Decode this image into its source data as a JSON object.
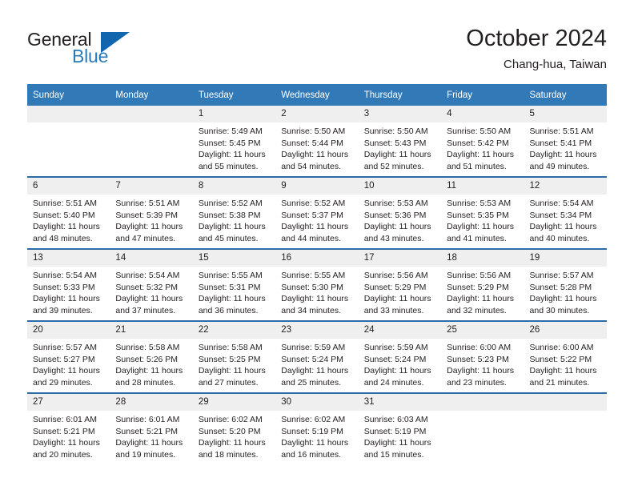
{
  "brand": {
    "name_part1": "General",
    "name_part2": "Blue",
    "triangle_color": "#1166ad",
    "blue_color": "#2b7ab8"
  },
  "header": {
    "title": "October 2024",
    "subtitle": "Chang-hua, Taiwan",
    "header_bg": "#3279b8",
    "row_divider": "#2d6ca8",
    "daynum_bg": "#efefef"
  },
  "weekday_headers": [
    "Sunday",
    "Monday",
    "Tuesday",
    "Wednesday",
    "Thursday",
    "Friday",
    "Saturday"
  ],
  "weeks": [
    [
      {
        "day": "",
        "sunrise": "",
        "sunset": "",
        "daylight1": "",
        "daylight2": "",
        "empty": true
      },
      {
        "day": "",
        "sunrise": "",
        "sunset": "",
        "daylight1": "",
        "daylight2": "",
        "empty": true
      },
      {
        "day": "1",
        "sunrise": "Sunrise: 5:49 AM",
        "sunset": "Sunset: 5:45 PM",
        "daylight1": "Daylight: 11 hours",
        "daylight2": "and 55 minutes."
      },
      {
        "day": "2",
        "sunrise": "Sunrise: 5:50 AM",
        "sunset": "Sunset: 5:44 PM",
        "daylight1": "Daylight: 11 hours",
        "daylight2": "and 54 minutes."
      },
      {
        "day": "3",
        "sunrise": "Sunrise: 5:50 AM",
        "sunset": "Sunset: 5:43 PM",
        "daylight1": "Daylight: 11 hours",
        "daylight2": "and 52 minutes."
      },
      {
        "day": "4",
        "sunrise": "Sunrise: 5:50 AM",
        "sunset": "Sunset: 5:42 PM",
        "daylight1": "Daylight: 11 hours",
        "daylight2": "and 51 minutes."
      },
      {
        "day": "5",
        "sunrise": "Sunrise: 5:51 AM",
        "sunset": "Sunset: 5:41 PM",
        "daylight1": "Daylight: 11 hours",
        "daylight2": "and 49 minutes."
      }
    ],
    [
      {
        "day": "6",
        "sunrise": "Sunrise: 5:51 AM",
        "sunset": "Sunset: 5:40 PM",
        "daylight1": "Daylight: 11 hours",
        "daylight2": "and 48 minutes."
      },
      {
        "day": "7",
        "sunrise": "Sunrise: 5:51 AM",
        "sunset": "Sunset: 5:39 PM",
        "daylight1": "Daylight: 11 hours",
        "daylight2": "and 47 minutes."
      },
      {
        "day": "8",
        "sunrise": "Sunrise: 5:52 AM",
        "sunset": "Sunset: 5:38 PM",
        "daylight1": "Daylight: 11 hours",
        "daylight2": "and 45 minutes."
      },
      {
        "day": "9",
        "sunrise": "Sunrise: 5:52 AM",
        "sunset": "Sunset: 5:37 PM",
        "daylight1": "Daylight: 11 hours",
        "daylight2": "and 44 minutes."
      },
      {
        "day": "10",
        "sunrise": "Sunrise: 5:53 AM",
        "sunset": "Sunset: 5:36 PM",
        "daylight1": "Daylight: 11 hours",
        "daylight2": "and 43 minutes."
      },
      {
        "day": "11",
        "sunrise": "Sunrise: 5:53 AM",
        "sunset": "Sunset: 5:35 PM",
        "daylight1": "Daylight: 11 hours",
        "daylight2": "and 41 minutes."
      },
      {
        "day": "12",
        "sunrise": "Sunrise: 5:54 AM",
        "sunset": "Sunset: 5:34 PM",
        "daylight1": "Daylight: 11 hours",
        "daylight2": "and 40 minutes."
      }
    ],
    [
      {
        "day": "13",
        "sunrise": "Sunrise: 5:54 AM",
        "sunset": "Sunset: 5:33 PM",
        "daylight1": "Daylight: 11 hours",
        "daylight2": "and 39 minutes."
      },
      {
        "day": "14",
        "sunrise": "Sunrise: 5:54 AM",
        "sunset": "Sunset: 5:32 PM",
        "daylight1": "Daylight: 11 hours",
        "daylight2": "and 37 minutes."
      },
      {
        "day": "15",
        "sunrise": "Sunrise: 5:55 AM",
        "sunset": "Sunset: 5:31 PM",
        "daylight1": "Daylight: 11 hours",
        "daylight2": "and 36 minutes."
      },
      {
        "day": "16",
        "sunrise": "Sunrise: 5:55 AM",
        "sunset": "Sunset: 5:30 PM",
        "daylight1": "Daylight: 11 hours",
        "daylight2": "and 34 minutes."
      },
      {
        "day": "17",
        "sunrise": "Sunrise: 5:56 AM",
        "sunset": "Sunset: 5:29 PM",
        "daylight1": "Daylight: 11 hours",
        "daylight2": "and 33 minutes."
      },
      {
        "day": "18",
        "sunrise": "Sunrise: 5:56 AM",
        "sunset": "Sunset: 5:29 PM",
        "daylight1": "Daylight: 11 hours",
        "daylight2": "and 32 minutes."
      },
      {
        "day": "19",
        "sunrise": "Sunrise: 5:57 AM",
        "sunset": "Sunset: 5:28 PM",
        "daylight1": "Daylight: 11 hours",
        "daylight2": "and 30 minutes."
      }
    ],
    [
      {
        "day": "20",
        "sunrise": "Sunrise: 5:57 AM",
        "sunset": "Sunset: 5:27 PM",
        "daylight1": "Daylight: 11 hours",
        "daylight2": "and 29 minutes."
      },
      {
        "day": "21",
        "sunrise": "Sunrise: 5:58 AM",
        "sunset": "Sunset: 5:26 PM",
        "daylight1": "Daylight: 11 hours",
        "daylight2": "and 28 minutes."
      },
      {
        "day": "22",
        "sunrise": "Sunrise: 5:58 AM",
        "sunset": "Sunset: 5:25 PM",
        "daylight1": "Daylight: 11 hours",
        "daylight2": "and 27 minutes."
      },
      {
        "day": "23",
        "sunrise": "Sunrise: 5:59 AM",
        "sunset": "Sunset: 5:24 PM",
        "daylight1": "Daylight: 11 hours",
        "daylight2": "and 25 minutes."
      },
      {
        "day": "24",
        "sunrise": "Sunrise: 5:59 AM",
        "sunset": "Sunset: 5:24 PM",
        "daylight1": "Daylight: 11 hours",
        "daylight2": "and 24 minutes."
      },
      {
        "day": "25",
        "sunrise": "Sunrise: 6:00 AM",
        "sunset": "Sunset: 5:23 PM",
        "daylight1": "Daylight: 11 hours",
        "daylight2": "and 23 minutes."
      },
      {
        "day": "26",
        "sunrise": "Sunrise: 6:00 AM",
        "sunset": "Sunset: 5:22 PM",
        "daylight1": "Daylight: 11 hours",
        "daylight2": "and 21 minutes."
      }
    ],
    [
      {
        "day": "27",
        "sunrise": "Sunrise: 6:01 AM",
        "sunset": "Sunset: 5:21 PM",
        "daylight1": "Daylight: 11 hours",
        "daylight2": "and 20 minutes."
      },
      {
        "day": "28",
        "sunrise": "Sunrise: 6:01 AM",
        "sunset": "Sunset: 5:21 PM",
        "daylight1": "Daylight: 11 hours",
        "daylight2": "and 19 minutes."
      },
      {
        "day": "29",
        "sunrise": "Sunrise: 6:02 AM",
        "sunset": "Sunset: 5:20 PM",
        "daylight1": "Daylight: 11 hours",
        "daylight2": "and 18 minutes."
      },
      {
        "day": "30",
        "sunrise": "Sunrise: 6:02 AM",
        "sunset": "Sunset: 5:19 PM",
        "daylight1": "Daylight: 11 hours",
        "daylight2": "and 16 minutes."
      },
      {
        "day": "31",
        "sunrise": "Sunrise: 6:03 AM",
        "sunset": "Sunset: 5:19 PM",
        "daylight1": "Daylight: 11 hours",
        "daylight2": "and 15 minutes."
      },
      {
        "day": "",
        "sunrise": "",
        "sunset": "",
        "daylight1": "",
        "daylight2": "",
        "empty": true
      },
      {
        "day": "",
        "sunrise": "",
        "sunset": "",
        "daylight1": "",
        "daylight2": "",
        "empty": true
      }
    ]
  ]
}
